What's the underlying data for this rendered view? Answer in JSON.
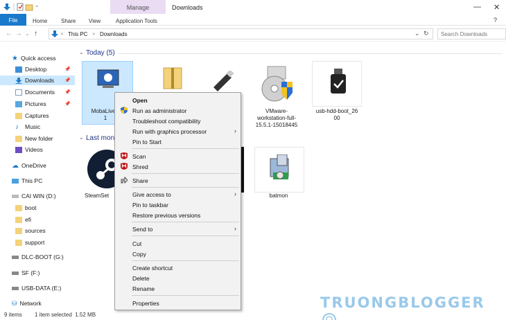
{
  "window": {
    "title": "Downloads",
    "manage_label": "Manage"
  },
  "ribbon": {
    "file": "File",
    "tabs": [
      "Home",
      "Share",
      "View",
      "Application Tools"
    ]
  },
  "address": {
    "breadcrumb": [
      "This PC",
      "Downloads"
    ],
    "search_placeholder": "Search Downloads"
  },
  "sidebar": {
    "items": [
      {
        "label": "Quick access",
        "icon": "star-icon"
      },
      {
        "label": "Desktop",
        "icon": "desktop-icon",
        "pinned": true
      },
      {
        "label": "Downloads",
        "icon": "download-icon",
        "pinned": true,
        "selected": true
      },
      {
        "label": "Documents",
        "icon": "document-icon",
        "pinned": true
      },
      {
        "label": "Pictures",
        "icon": "picture-icon",
        "pinned": true
      },
      {
        "label": "Captures",
        "icon": "folder-icon"
      },
      {
        "label": "Music",
        "icon": "music-icon"
      },
      {
        "label": "New folder",
        "icon": "folder-icon"
      },
      {
        "label": "Videos",
        "icon": "video-icon"
      },
      {
        "label": "OneDrive",
        "icon": "cloud-icon"
      },
      {
        "label": "This PC",
        "icon": "pc-icon"
      },
      {
        "label": "CAI WIN (D:)",
        "icon": "drive-icon"
      },
      {
        "label": "boot",
        "icon": "folder-icon"
      },
      {
        "label": "efi",
        "icon": "folder-icon"
      },
      {
        "label": "sources",
        "icon": "folder-icon"
      },
      {
        "label": "support",
        "icon": "folder-icon"
      },
      {
        "label": "DLC-BOOT (G:)",
        "icon": "drive-icon"
      },
      {
        "label": "SF (F:)",
        "icon": "drive-icon"
      },
      {
        "label": "USB-DATA (E:)",
        "icon": "drive-icon"
      },
      {
        "label": "Network",
        "icon": "network-icon"
      }
    ]
  },
  "groups": {
    "today": "Today (5)",
    "last_month": "Last mon"
  },
  "files": {
    "today": [
      {
        "label": "MobaLiveC\n1",
        "selected": true
      },
      {
        "label": ""
      },
      {
        "label": ""
      },
      {
        "label": "VMware-workstation-full-15.5.1-15018445"
      },
      {
        "label": "usb-hdd-boot_2600"
      }
    ],
    "last_month": [
      {
        "label": "SteamSet"
      },
      {
        "label": ""
      },
      {
        "label": "batmon"
      }
    ]
  },
  "context_menu": {
    "items": [
      {
        "label": "Open",
        "bold": true
      },
      {
        "label": "Run as administrator",
        "icon": "shield-icon"
      },
      {
        "label": "Troubleshoot compatibility"
      },
      {
        "label": "Run with graphics processor",
        "submenu": true
      },
      {
        "label": "Pin to Start"
      },
      {
        "label": "Scan",
        "icon": "mcafee-icon"
      },
      {
        "label": "Shred",
        "icon": "mcafee-icon"
      },
      {
        "label": "Share",
        "icon": "share-icon"
      },
      {
        "label": "Give access to",
        "submenu": true
      },
      {
        "label": "Pin to taskbar"
      },
      {
        "label": "Restore previous versions"
      },
      {
        "label": "Send to",
        "submenu": true
      },
      {
        "label": "Cut"
      },
      {
        "label": "Copy"
      },
      {
        "label": "Create shortcut"
      },
      {
        "label": "Delete"
      },
      {
        "label": "Rename"
      },
      {
        "label": "Properties"
      }
    ]
  },
  "status": {
    "items": "9 items",
    "selected": "1 item selected  1.52 MB"
  },
  "watermark": "TRUONGBLOGGER"
}
